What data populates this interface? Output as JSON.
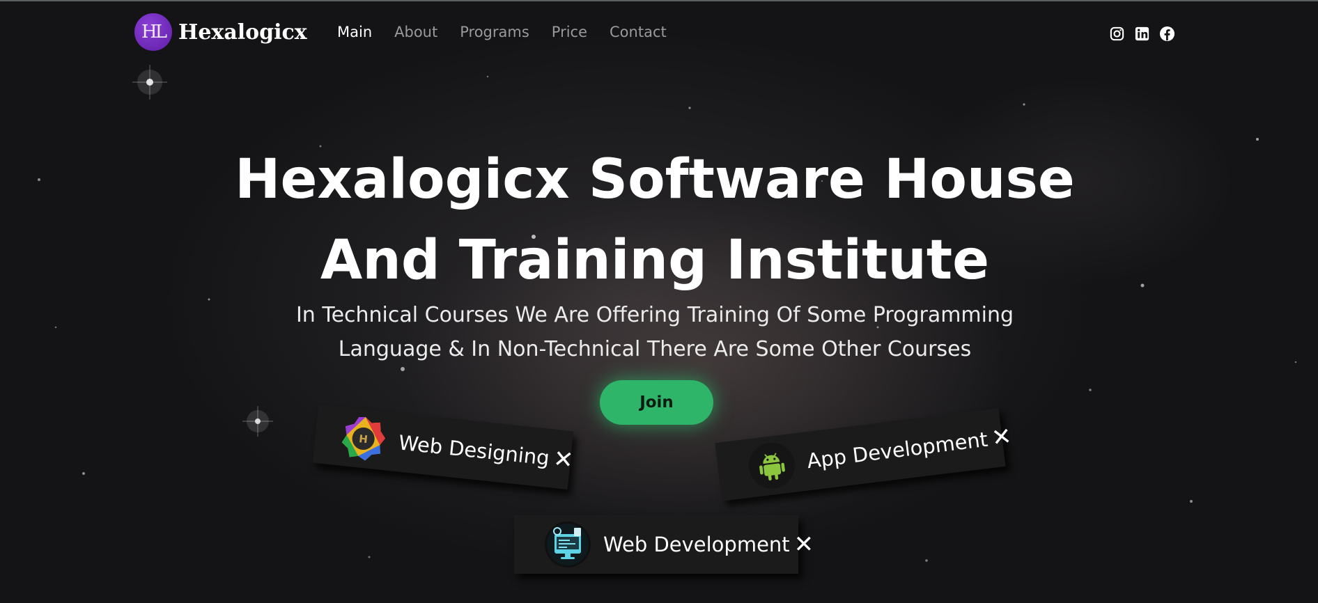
{
  "brand": {
    "logo_text": "HL",
    "name": "Hexalogicx"
  },
  "nav": {
    "items": [
      {
        "label": "Main",
        "active": true
      },
      {
        "label": "About",
        "active": false
      },
      {
        "label": "Programs",
        "active": false
      },
      {
        "label": "Price",
        "active": false
      },
      {
        "label": "Contact",
        "active": false
      }
    ]
  },
  "social": [
    "instagram-icon",
    "linkedin-icon",
    "facebook-icon"
  ],
  "hero": {
    "title_line1": "Hexalogicx Software House",
    "title_line2": "And Training Institute",
    "subtitle_line1": "In Technical Courses We Are Offering Training Of Some Programming",
    "subtitle_line2": "Language & In Non-Technical There Are Some Other Courses",
    "join_label": "Join"
  },
  "cards": {
    "web_designing": {
      "label": "Web Designing",
      "close": "✕"
    },
    "app_development": {
      "label": "App Development",
      "close": "✕"
    },
    "web_development": {
      "label": "Web Development",
      "close": "✕"
    }
  },
  "colors": {
    "accent_green": "#2fb56a",
    "brand_purple": "#6a24b3",
    "background": "#141416",
    "nav_inactive": "#9a9a9a"
  }
}
